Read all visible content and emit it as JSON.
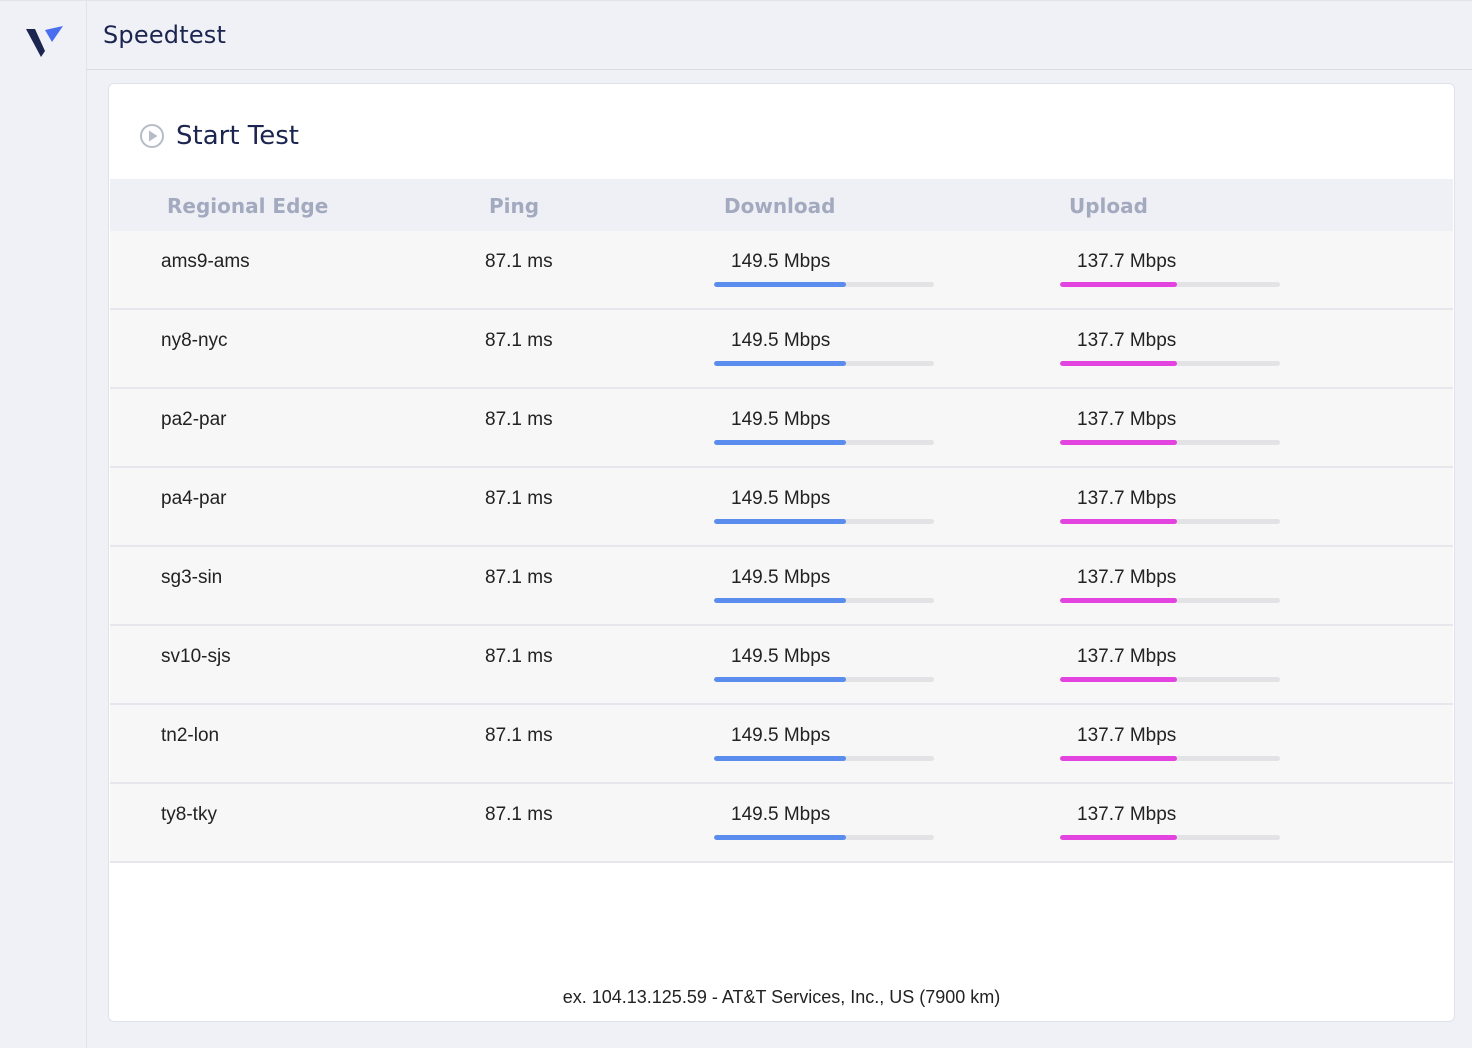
{
  "app": {
    "title": "Speedtest",
    "logo_icon": "v-logo-icon",
    "colors": {
      "brand_dark": "#1b2550",
      "brand_blue": "#4a6ef0",
      "download_bar": "#5b8def",
      "upload_bar": "#e344e0",
      "header_text": "#a3aac0"
    }
  },
  "start_test": {
    "label": "Start Test",
    "icon": "play-circle-icon"
  },
  "table": {
    "headers": {
      "edge": "Regional Edge",
      "ping": "Ping",
      "download": "Download",
      "upload": "Upload"
    },
    "rows": [
      {
        "edge": "ams9-ams",
        "ping": "87.1 ms",
        "download": "149.5 Mbps",
        "download_pct": 60,
        "upload": "137.7 Mbps",
        "upload_pct": 53
      },
      {
        "edge": "ny8-nyc",
        "ping": "87.1 ms",
        "download": "149.5 Mbps",
        "download_pct": 60,
        "upload": "137.7 Mbps",
        "upload_pct": 53
      },
      {
        "edge": "pa2-par",
        "ping": "87.1 ms",
        "download": "149.5 Mbps",
        "download_pct": 60,
        "upload": "137.7 Mbps",
        "upload_pct": 53
      },
      {
        "edge": "pa4-par",
        "ping": "87.1 ms",
        "download": "149.5 Mbps",
        "download_pct": 60,
        "upload": "137.7 Mbps",
        "upload_pct": 53
      },
      {
        "edge": "sg3-sin",
        "ping": "87.1 ms",
        "download": "149.5 Mbps",
        "download_pct": 60,
        "upload": "137.7 Mbps",
        "upload_pct": 53
      },
      {
        "edge": "sv10-sjs",
        "ping": "87.1 ms",
        "download": "149.5 Mbps",
        "download_pct": 60,
        "upload": "137.7 Mbps",
        "upload_pct": 53
      },
      {
        "edge": "tn2-lon",
        "ping": "87.1 ms",
        "download": "149.5 Mbps",
        "download_pct": 60,
        "upload": "137.7 Mbps",
        "upload_pct": 53
      },
      {
        "edge": "ty8-tky",
        "ping": "87.1 ms",
        "download": "149.5 Mbps",
        "download_pct": 60,
        "upload": "137.7 Mbps",
        "upload_pct": 53
      }
    ]
  },
  "footer": {
    "text": "ex. 104.13.125.59 - AT&T Services, Inc., US (7900 km)"
  }
}
